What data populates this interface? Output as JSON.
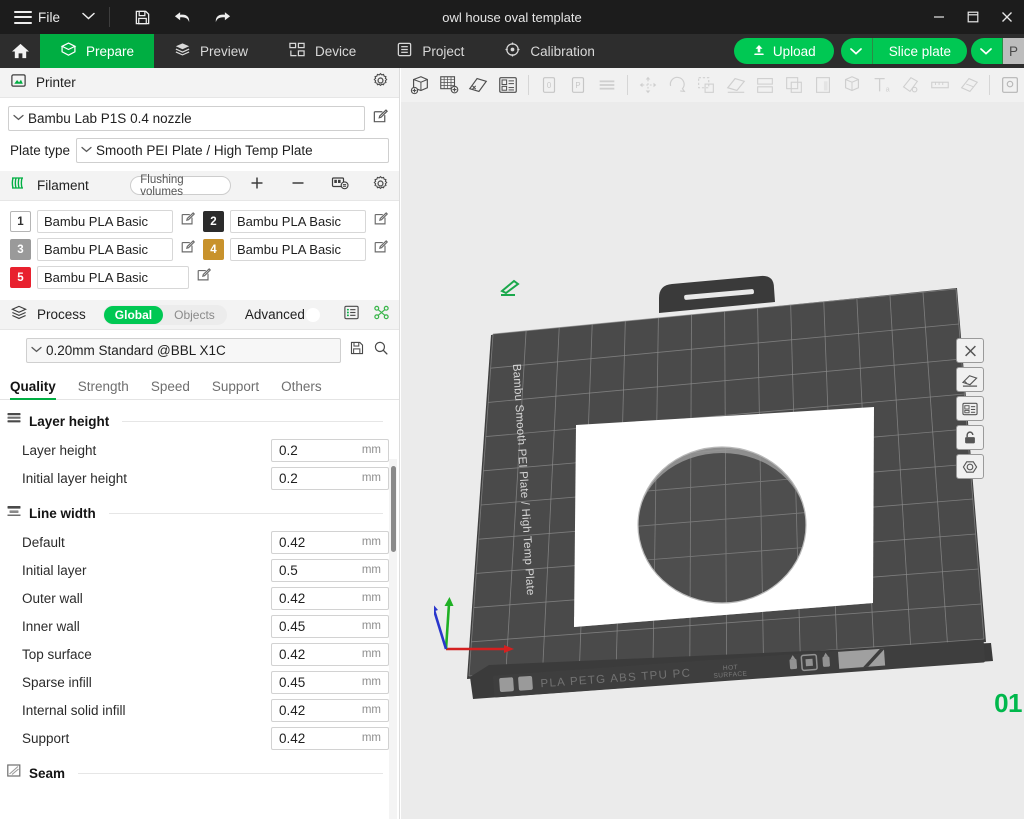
{
  "titlebar": {
    "menu_label": "File",
    "document_title": "owl house oval template",
    "icons": {
      "save": "save-icon",
      "undo": "undo-icon",
      "redo": "redo-icon"
    },
    "window_buttons": {
      "minimize": "–",
      "maximize": "❐",
      "close": "✕"
    }
  },
  "topnav": {
    "home": "home-icon",
    "tabs": [
      {
        "label": "Prepare",
        "icon": "prepare-icon",
        "active": true
      },
      {
        "label": "Preview",
        "icon": "preview-icon",
        "active": false
      },
      {
        "label": "Device",
        "icon": "device-icon",
        "active": false
      },
      {
        "label": "Project",
        "icon": "project-icon",
        "active": false
      },
      {
        "label": "Calibration",
        "icon": "calibration-icon",
        "active": false
      }
    ],
    "upload_label": "Upload",
    "slice_label": "Slice plate",
    "print_label": "P",
    "accent_green": "#00c853",
    "tab_active_green": "#00ae42"
  },
  "printer": {
    "section_label": "Printer",
    "section_icon": "printer-icon",
    "settings_icon": "gear-icon",
    "preset": "Bambu Lab P1S 0.4 nozzle",
    "edit_icon": "edit-icon",
    "plate_type_label": "Plate type",
    "plate_type_value": "Smooth PEI Plate / High Temp Plate"
  },
  "filament": {
    "section_label": "Filament",
    "section_icon": "filament-icon",
    "flushing_volumes_label": "Flushing volumes",
    "add_icon": "plus-icon",
    "remove_icon": "minus-icon",
    "ams_icon": "ams-icon",
    "settings_icon": "gear-icon",
    "slots": [
      {
        "index": "1",
        "name": "Bambu PLA Basic",
        "color": "#ffffff",
        "text_color": "#303030"
      },
      {
        "index": "2",
        "name": "Bambu PLA Basic",
        "color": "#2b2b2b",
        "text_color": "#ffffff"
      },
      {
        "index": "3",
        "name": "Bambu PLA Basic",
        "color": "#9a9a9a",
        "text_color": "#ffffff"
      },
      {
        "index": "4",
        "name": "Bambu PLA Basic",
        "color": "#c8922c",
        "text_color": "#ffffff"
      },
      {
        "index": "5",
        "name": "Bambu PLA Basic",
        "color": "#e8212e",
        "text_color": "#ffffff"
      }
    ]
  },
  "process": {
    "section_label": "Process",
    "section_icon": "process-icon",
    "scope_global": "Global",
    "scope_objects": "Objects",
    "advanced_label": "Advanced",
    "advanced_on": true,
    "list_icon": "list-icon",
    "compare_icon": "compare-icon",
    "preset": "0.20mm Standard @BBL X1C",
    "save_icon": "save-preset-icon",
    "search_icon": "search-icon",
    "tabs": [
      {
        "label": "Quality",
        "active": true
      },
      {
        "label": "Strength",
        "active": false
      },
      {
        "label": "Speed",
        "active": false
      },
      {
        "label": "Support",
        "active": false
      },
      {
        "label": "Others",
        "active": false
      }
    ],
    "groups": [
      {
        "title": "Layer height",
        "icon": "layers-icon",
        "rows": [
          {
            "name": "Layer height",
            "value": "0.2",
            "unit": "mm"
          },
          {
            "name": "Initial layer height",
            "value": "0.2",
            "unit": "mm"
          }
        ]
      },
      {
        "title": "Line width",
        "icon": "linewidth-icon",
        "rows": [
          {
            "name": "Default",
            "value": "0.42",
            "unit": "mm"
          },
          {
            "name": "Initial layer",
            "value": "0.5",
            "unit": "mm"
          },
          {
            "name": "Outer wall",
            "value": "0.42",
            "unit": "mm"
          },
          {
            "name": "Inner wall",
            "value": "0.45",
            "unit": "mm"
          },
          {
            "name": "Top surface",
            "value": "0.42",
            "unit": "mm"
          },
          {
            "name": "Sparse infill",
            "value": "0.45",
            "unit": "mm"
          },
          {
            "name": "Internal solid infill",
            "value": "0.42",
            "unit": "mm"
          },
          {
            "name": "Support",
            "value": "0.42",
            "unit": "mm"
          }
        ]
      },
      {
        "title": "Seam",
        "icon": "seam-icon",
        "rows": []
      }
    ]
  },
  "viewport": {
    "toolbar_icons": [
      {
        "name": "add-object-icon",
        "enabled": true
      },
      {
        "name": "add-plate-icon",
        "enabled": true
      },
      {
        "name": "delete-object-icon",
        "enabled": true
      },
      {
        "name": "auto-arrange-icon",
        "enabled": true
      },
      {
        "name": "orient-0-icon",
        "enabled": false
      },
      {
        "name": "orient-p-icon",
        "enabled": false
      },
      {
        "name": "variable-layer-icon",
        "enabled": false
      },
      {
        "name": "move-icon",
        "enabled": false
      },
      {
        "name": "rotate-icon",
        "enabled": false
      },
      {
        "name": "scale-icon",
        "enabled": false
      },
      {
        "name": "place-on-face-icon",
        "enabled": false
      },
      {
        "name": "cut-icon",
        "enabled": false
      },
      {
        "name": "mesh-boolean-icon",
        "enabled": false
      },
      {
        "name": "support-paint-icon",
        "enabled": false
      },
      {
        "name": "color-paint-icon",
        "enabled": false
      },
      {
        "name": "text-icon",
        "enabled": false
      },
      {
        "name": "svg-icon",
        "enabled": false
      },
      {
        "name": "measure-icon",
        "enabled": false
      },
      {
        "name": "assembly-icon",
        "enabled": false
      },
      {
        "name": "simplify-icon",
        "enabled": false
      }
    ],
    "plate_controls": [
      {
        "name": "delete-plate-icon"
      },
      {
        "name": "arrange-plate-icon"
      },
      {
        "name": "plate-settings-icon"
      },
      {
        "name": "lock-plate-icon"
      },
      {
        "name": "filament-map-icon"
      }
    ],
    "plate_number": "01",
    "plate_side_text": "Bambu Smooth PEI Plate / High Temp Plate",
    "plate_strip_materials": "PLA PETG ABS TPU PC",
    "plate_strip_warning": "HOT SURFACE",
    "axis": {
      "x": "X",
      "y": "Y",
      "z": "Z",
      "x_color": "#d42020",
      "y_color": "#1fb024",
      "z_color": "#2a36cc"
    },
    "background": "#ebebeb",
    "plate_color": "#4a4a4a",
    "model_color": "#ffffff"
  }
}
